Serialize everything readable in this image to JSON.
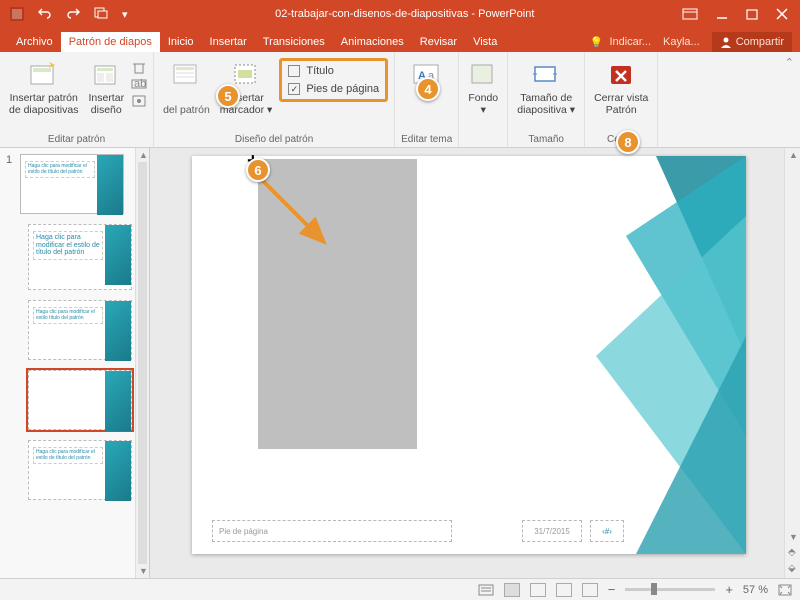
{
  "titlebar": {
    "doc": "02-trabajar-con-disenos-de-diapositivas",
    "app": "PowerPoint"
  },
  "tabs": {
    "archivo": "Archivo",
    "patron": "Patrón de diapos",
    "inicio": "Inicio",
    "insertar": "Insertar",
    "transiciones": "Transiciones",
    "animaciones": "Animaciones",
    "revisar": "Revisar",
    "vista": "Vista",
    "tell": "Indicar...",
    "user": "Kayla...",
    "share": "Compartir"
  },
  "ribbon": {
    "insertar_patron": "Insertar patrón\nde diapositivas",
    "insertar_diseno": "Insertar\ndiseño",
    "del_patron": "\ndel patrón",
    "insertar_marcador": "Insertar\nmarcador",
    "titulo": "Título",
    "pies": "Pies de página",
    "fondo": "Fondo",
    "tamano": "Tamaño de\ndiapositiva",
    "cerrar": "Cerrar vista\nPatrón",
    "grp_editar": "Editar patrón",
    "grp_diseno": "Diseño del patrón",
    "grp_tema": "Editar tema",
    "grp_tamano": "Tamaño",
    "grp_cerrar": "Cerrar"
  },
  "thumbs": {
    "master": "Haga clic para modificar el estilo de título del patrón",
    "layout1": "Haga clic para modificar el estilo de título del patrón",
    "layout2": "Haga clic para modificar el estilo título del patrón",
    "layout4": "Haga clic para modificar el estilo de título del patrón"
  },
  "slide": {
    "footer": "Pie de página",
    "date": "31/7/2015",
    "num": "‹#›"
  },
  "callouts": {
    "c4": "4",
    "c5": "5",
    "c6": "6",
    "c8": "8"
  },
  "status": {
    "zoom": "57 %"
  }
}
